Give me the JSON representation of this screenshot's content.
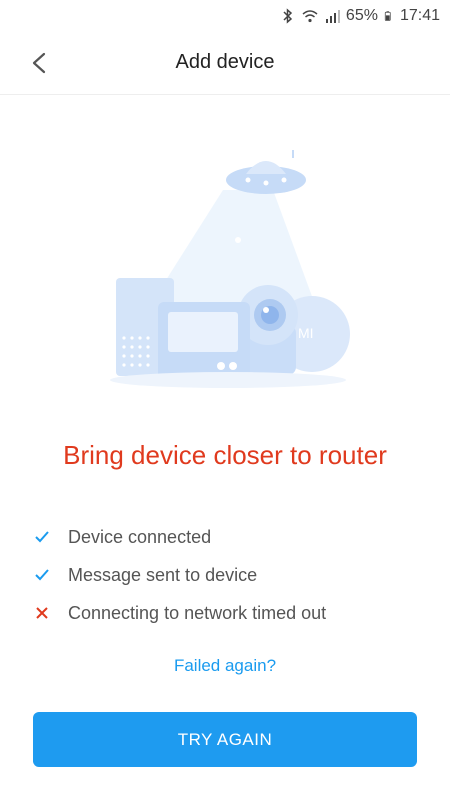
{
  "status_bar": {
    "icons": [
      "bluetooth-icon",
      "wifi-icon",
      "signal-icon",
      "battery-icon"
    ],
    "battery": "65%",
    "time": "17:41"
  },
  "header": {
    "title": "Add device",
    "back_icon": "chevron-left-icon"
  },
  "main": {
    "illustration": "smart-devices-ufo-illustration",
    "headline": "Bring device closer to router",
    "steps": [
      {
        "label": "Device connected",
        "status": "done",
        "icon": "check-icon"
      },
      {
        "label": "Message sent to device",
        "status": "done",
        "icon": "check-icon"
      },
      {
        "label": "Connecting to network timed out",
        "status": "failed",
        "icon": "cross-icon"
      }
    ],
    "retry_link": "Failed again?",
    "button_label": "TRY AGAIN"
  },
  "colors": {
    "accent": "#1e9bf0",
    "error": "#e03a1e",
    "check": "#1a9bef"
  }
}
